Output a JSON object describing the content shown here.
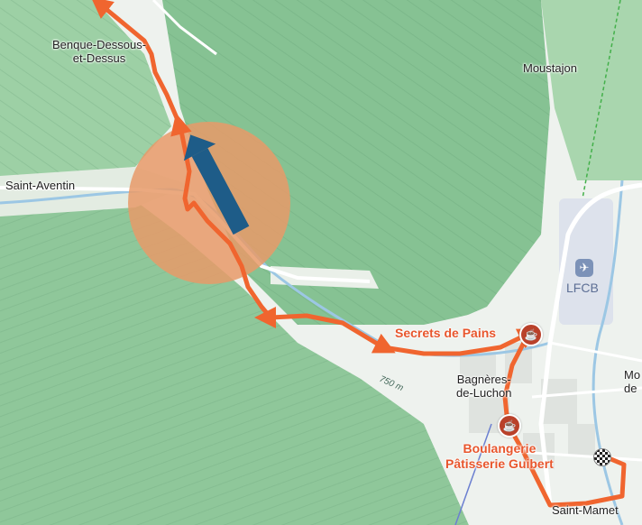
{
  "map": {
    "places": {
      "benque": {
        "line1": "Benque-Dessous-",
        "line2": "et-Dessus"
      },
      "moustajon": "Moustajon",
      "saint_aventin": "Saint-Aventin",
      "bagneres": {
        "line1": "Bagnères-",
        "line2": "de-Luchon"
      },
      "saint_mamet": "Saint-Mamet",
      "partial_right": {
        "line1": "Mo",
        "line2": "de"
      }
    },
    "airport": {
      "code": "LFCB",
      "icon": "airplane-icon"
    },
    "pois": {
      "secrets": {
        "name": "Secrets de Pains",
        "icon": "coffee-cup-icon"
      },
      "boulangerie": {
        "line1": "Boulangerie",
        "line2": "Pâtisserie Guibert",
        "icon": "coffee-cup-icon"
      }
    },
    "elevation_label": "750 m",
    "position_marker": {
      "icon": "direction-arrow-icon"
    },
    "finish_marker": {
      "icon": "checkered-flag-icon"
    },
    "colors": {
      "route": "#f0652f",
      "position_halo": "#e89a68",
      "direction_arrow": "#1e5c88",
      "poi_text": "#e8562d",
      "poi_pin": "#b9412a",
      "forest": "#8fc79a",
      "valley": "#eef2ee",
      "river": "#9cc7e4"
    }
  }
}
